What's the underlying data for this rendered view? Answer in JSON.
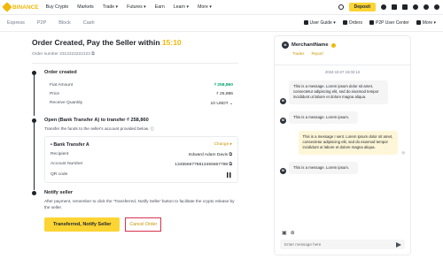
{
  "header": {
    "brand": "BINANCE",
    "nav": [
      "Buy Crypto",
      "Markets",
      "Trade ▾",
      "Futures ▾",
      "Earn",
      "Learn ▾",
      "More ▾"
    ],
    "deposit_label": "Deposit"
  },
  "subnav": {
    "tabs": [
      "Express",
      "P2P",
      "Block",
      "Cash"
    ],
    "right": [
      "User Guide ▾",
      "Orders",
      "P2P User Center",
      "More ▾"
    ]
  },
  "order": {
    "title": "Order Created, Pay the Seller within",
    "timer": "15:10",
    "order_number_label": "Order number",
    "order_number": "2312222222123"
  },
  "step1": {
    "title": "Order created",
    "rows": [
      {
        "label": "Fiat Amount",
        "value": "₫ 258,860",
        "accent": true
      },
      {
        "label": "Price",
        "value": "₫ 25,886",
        "accent": false
      },
      {
        "label": "Receive Quantity",
        "value": "10 USDT ⌄",
        "accent": false
      }
    ]
  },
  "step2": {
    "title": "Open (Bank Transfer A) to transfer ₫ 258,860",
    "subtitle": "Transfer the funds to the seller's account provided below. ⓘ",
    "method": "Bank Transfer A",
    "change_label": "Change ▸",
    "rows": [
      {
        "label": "Recipient",
        "value": "Edward Adam Davis"
      },
      {
        "label": "Account Number",
        "value": "1345566778813455667788"
      },
      {
        "label": "QR code",
        "value": ""
      }
    ]
  },
  "step3": {
    "title": "Notify seller",
    "subtitle": "After payment, remember to click the 'Transferred, Notify Seller' button to facilitate the crypto release by the seller.",
    "primary_label": "Transferred, Notify Seller",
    "cancel_label": "Cancel Order"
  },
  "chat": {
    "merchant": "MerchantName",
    "links": [
      "Trades",
      "Report"
    ],
    "timestamp": "2024-10-27 15:02:13",
    "messages": [
      {
        "from": "them",
        "text": "This is a message. Lorem ipsum dolor sit amet, consectetur adipiscing elit, sed do eiusmod tempor incididunt ut labore et dolore magna aliqua."
      },
      {
        "from": "them",
        "text": "This is a message. Lorem ipsum."
      },
      {
        "from": "me",
        "text": "This is a message I sent. Lorem ipsum dolor sit amet, consectetur adipiscing elit, sed do eiusmod tempor incididunt ut labore et dolore magna aliqua."
      },
      {
        "from": "them",
        "text": "This is a message. Lorem ipsum."
      }
    ],
    "input_placeholder": "Enter message here",
    "avatar_initial": "M"
  }
}
